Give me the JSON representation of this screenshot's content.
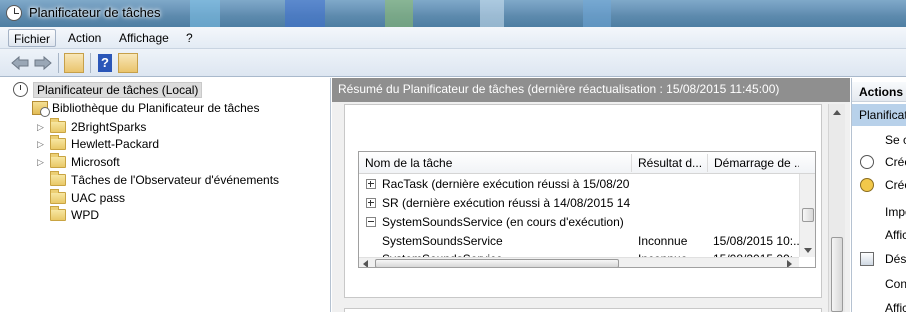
{
  "window": {
    "title": "Planificateur de tâches"
  },
  "menubar": {
    "items": [
      "Fichier",
      "Action",
      "Affichage",
      "?"
    ]
  },
  "toolbar": {
    "back": "back-icon",
    "forward": "forward-icon",
    "help": "?"
  },
  "tree": {
    "root": "Planificateur de tâches (Local)",
    "library": "Bibliothèque du Planificateur de tâches",
    "folders": [
      {
        "label": "2BrightSparks",
        "expandable": true
      },
      {
        "label": "Hewlett-Packard",
        "expandable": true
      },
      {
        "label": "Microsoft",
        "expandable": true
      },
      {
        "label": "Tâches de l'Observateur d'événements",
        "expandable": false
      },
      {
        "label": "UAC pass",
        "expandable": false
      },
      {
        "label": "WPD",
        "expandable": false
      }
    ]
  },
  "center": {
    "header": "Résumé du Planificateur de tâches (dernière réactualisation : 15/08/2015 11:45:00)",
    "grid": {
      "columns": [
        "Nom de la tâche",
        "Résultat d...",
        "Démarrage de ..."
      ],
      "rows": [
        {
          "type": "group",
          "expanded": false,
          "name": "RacTask (dernière exécution réussi à 15/08/20...",
          "result": "",
          "start": ""
        },
        {
          "type": "group",
          "expanded": false,
          "name": "SR (dernière exécution réussi à 14/08/2015 14:...",
          "result": "",
          "start": ""
        },
        {
          "type": "group",
          "expanded": true,
          "name": "SystemSoundsService (en cours d'exécution)",
          "result": "",
          "start": ""
        },
        {
          "type": "item",
          "name": "SystemSoundsService",
          "result": "Inconnue",
          "start": "15/08/2015 10:..."
        },
        {
          "type": "item",
          "name": "SystemSoundsService",
          "result": "Inconnue",
          "start": "15/08/2015 09:..."
        }
      ]
    }
  },
  "actions": {
    "title": "Actions",
    "section": "Planificateur de tâches (Local)",
    "items": [
      {
        "label": "Se connecter à un autre ordinateur...",
        "icon": ""
      },
      {
        "label": "Créer une tâche de base...",
        "icon": "clock-icon"
      },
      {
        "label": "Créer une tâche...",
        "icon": "task-icon"
      },
      {
        "label": "Importer une tâche...",
        "icon": ""
      },
      {
        "label": "Afficher toutes les tâches en cours d'exécution",
        "icon": ""
      },
      {
        "label": "Désactiver l'historique de toutes les tâches",
        "icon": "document-icon"
      },
      {
        "label": "Configuration du compte du service AT",
        "icon": ""
      },
      {
        "label": "Affichage",
        "icon": ""
      }
    ]
  }
}
